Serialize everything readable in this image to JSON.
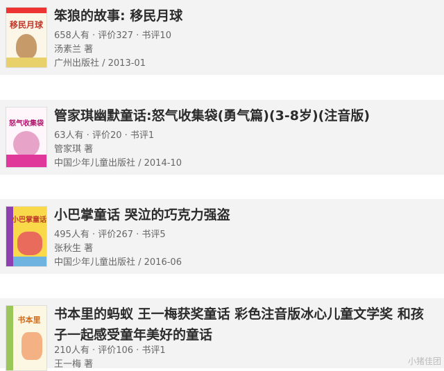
{
  "books": [
    {
      "title": "笨狼的故事: 移民月球",
      "stats": "658人有 · 评价327 · 书评10",
      "author": "汤素兰 著",
      "publisher": "广州出版社 / 2013-01",
      "cover_text": "移民月球",
      "cover_color": "#d8c8a8"
    },
    {
      "title": "管家琪幽默童话:怒气收集袋(勇气篇)(3-8岁)(注音版)",
      "stats": "63人有 · 评价20 · 书评1",
      "author": "管家琪 著",
      "publisher": "中国少年儿童出版社 / 2014-10",
      "cover_text": "怒气收集袋",
      "cover_color": "#e0389a"
    },
    {
      "title": "小巴掌童话 哭泣的巧克力强盗",
      "stats": "495人有 · 评价267 · 书评5",
      "author": "张秋生 著",
      "publisher": "中国少年儿童出版社 / 2016-06",
      "cover_text": "小巴掌童话",
      "cover_color": "#f2c21e"
    },
    {
      "title": "书本里的蚂蚁 王一梅获奖童话 彩色注音版冰心儿童文学奖 和孩子一起感受童年美好的童话",
      "stats": "210人有 · 评价106 · 书评1",
      "author": "王一梅 著",
      "publisher": "",
      "cover_text": "书本里",
      "cover_color": "#9bc75a"
    }
  ],
  "watermark": "小猪佳团"
}
